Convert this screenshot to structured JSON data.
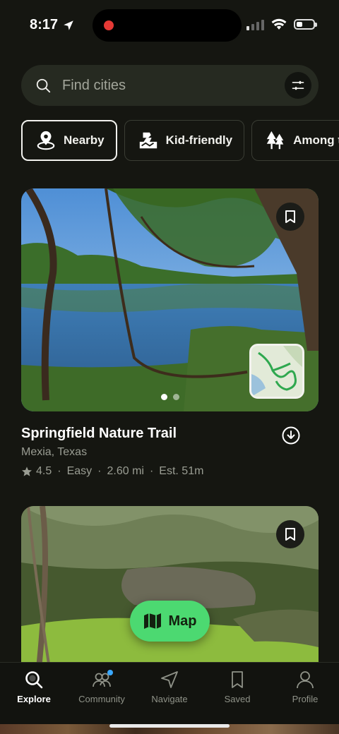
{
  "status_bar": {
    "time": "8:17",
    "icons": [
      "location-arrow-icon",
      "cellular-signal-icon",
      "wifi-icon",
      "battery-icon"
    ]
  },
  "search": {
    "placeholder": "Find cities"
  },
  "chips": [
    {
      "label": "Nearby",
      "icon": "location-pin-icon",
      "active": true
    },
    {
      "label": "Kid-friendly",
      "icon": "kid-friendly-icon",
      "active": false
    },
    {
      "label": "Among trees",
      "icon": "trees-icon",
      "active": false
    }
  ],
  "trails": [
    {
      "name": "Springfield Nature Trail",
      "location": "Mexia, Texas",
      "rating": "4.5",
      "difficulty": "Easy",
      "distance": "2.60 mi",
      "estimate": "Est. 51m",
      "photo_index": 1,
      "photo_count": 2
    }
  ],
  "map_button": {
    "label": "Map"
  },
  "tabs": [
    {
      "label": "Explore",
      "icon": "search-icon",
      "active": true
    },
    {
      "label": "Community",
      "icon": "community-icon",
      "active": false,
      "has_badge": true
    },
    {
      "label": "Navigate",
      "icon": "navigate-icon",
      "active": false
    },
    {
      "label": "Saved",
      "icon": "bookmark-icon",
      "active": false
    },
    {
      "label": "Profile",
      "icon": "profile-icon",
      "active": false
    }
  ],
  "colors": {
    "background": "#151611",
    "accent": "#4cd971",
    "badge": "#3aa8ff",
    "search_bg": "#262a21"
  }
}
